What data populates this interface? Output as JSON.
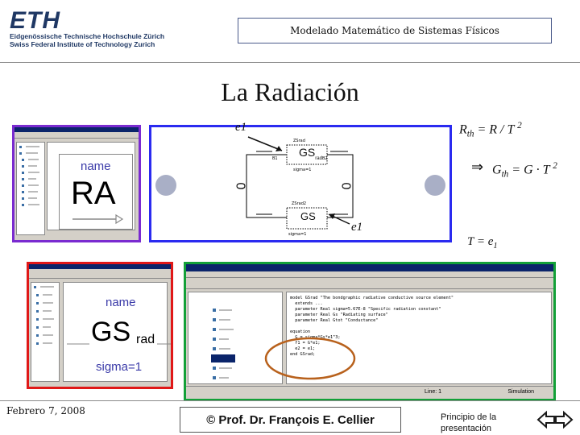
{
  "logo": {
    "mark": "ETH",
    "line1": "Eidgenössische Technische Hochschule Zürich",
    "line2": "Swiss Federal Institute of Technology Zurich"
  },
  "header": {
    "course_title": "Modelado Matemático de Sistemas Físicos"
  },
  "slide": {
    "title": "La Radiación"
  },
  "diagram": {
    "e1_top": "e1",
    "e1_bottom": "e1",
    "zero_left": "0",
    "zero_right": "0",
    "top_element_label": "GS",
    "top_element_sub": "rad",
    "bottom_element_label": "GS"
  },
  "equations": {
    "rth": "R",
    "rth_sub": "th",
    "rth_rest": " = R / T ",
    "rth_exp": "2",
    "implies": "⇒",
    "gth": "G",
    "gth_sub": "th",
    "gth_rest": " = G · T ",
    "gth_exp": "2",
    "t_eq": "T = e",
    "t_sub": "1"
  },
  "icon_ra": {
    "name": "name",
    "label": "RA"
  },
  "icon_gs": {
    "name": "name",
    "label": "GS",
    "sub": "rad",
    "param": "sigma=1"
  },
  "editor": {
    "code_lines": [
      "model GSrad \"The bondgraphic radiative conductive source element\"",
      "  extends ...",
      "  parameter Real sigma=5.67E-8 \"Specific radiation constant\"",
      "  parameter Real Gs \"Radiating surface\"",
      "  parameter Real Gtot \"Conductance\"",
      "",
      "equation",
      "  G = sigma*Gs*e1^3;",
      "  f1 = G*e1;",
      "  e2 = e1;",
      "end GSrad;"
    ],
    "status_left": "Line: 1",
    "status_right": "Simulation"
  },
  "footer": {
    "date": "Febrero 7, 2008",
    "author": "© Prof. Dr. François E. Cellier",
    "link_line1": "Principio de la",
    "link_line2": "presentación"
  },
  "colors": {
    "frame_purple": "#7a2bd0",
    "frame_blue": "#2a2af0",
    "frame_red": "#e01818",
    "frame_green": "#13a038",
    "ellipse": "#b8611c",
    "arrow": "#1a1a1a",
    "link_icon_left": "#1a73c8",
    "link_icon_right": "#d94a1a"
  }
}
